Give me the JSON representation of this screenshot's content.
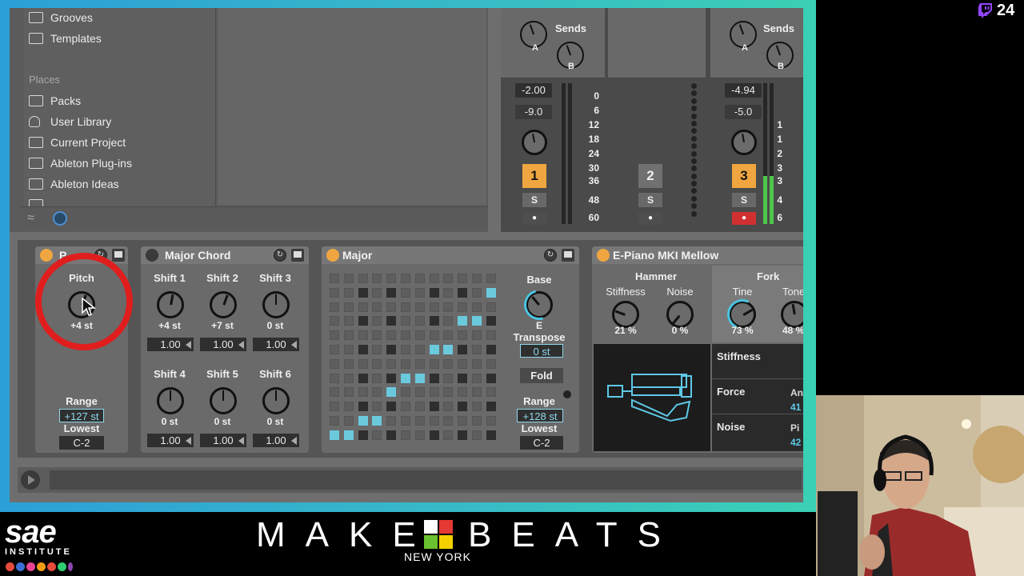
{
  "browser": {
    "items_top": [
      {
        "label": "Grooves",
        "icon": "grooves-icon"
      },
      {
        "label": "Templates",
        "icon": "templates-icon"
      }
    ],
    "places_header": "Places",
    "places": [
      {
        "label": "Packs",
        "icon": "packs-icon"
      },
      {
        "label": "User Library",
        "icon": "person-icon"
      },
      {
        "label": "Current Project",
        "icon": "project-icon"
      },
      {
        "label": "Ableton Plug-ins",
        "icon": "folder-icon"
      },
      {
        "label": "Ableton Ideas",
        "icon": "folder-icon"
      }
    ]
  },
  "mixer": {
    "sends_label": "Sends",
    "send_a": "A",
    "send_b": "B",
    "strip1": {
      "volume": "-2.00",
      "pan": "-9.0",
      "number": "1",
      "solo": "S"
    },
    "strip2": {
      "number": "2",
      "solo": "S"
    },
    "strip3": {
      "volume": "-4.94",
      "pan": "-5.0",
      "number": "3",
      "solo": "S"
    },
    "scale": [
      "0",
      "6",
      "12",
      "18",
      "24",
      "30",
      "36",
      "48",
      "60"
    ],
    "scale_partial": [
      "1",
      "1",
      "2",
      "3",
      "3",
      "4",
      "6"
    ]
  },
  "devices": {
    "pitch": {
      "name_partial": "P",
      "pitch_label": "Pitch",
      "pitch_value": "+4 st",
      "range_label": "Range",
      "range_value": "+127 st",
      "lowest_label": "Lowest",
      "lowest_value": "C-2"
    },
    "major_chord": {
      "name": "Major Chord",
      "shifts": [
        {
          "label": "Shift 1",
          "value": "+4 st",
          "vel": "1.00"
        },
        {
          "label": "Shift 2",
          "value": "+7 st",
          "vel": "1.00"
        },
        {
          "label": "Shift 3",
          "value": "0 st",
          "vel": "1.00"
        },
        {
          "label": "Shift 4",
          "value": "0 st",
          "vel": "1.00"
        },
        {
          "label": "Shift 5",
          "value": "0 st",
          "vel": "1.00"
        },
        {
          "label": "Shift 6",
          "value": "0 st",
          "vel": "1.00"
        }
      ]
    },
    "major": {
      "name": "Major",
      "base_label": "Base",
      "base_value": "E",
      "transpose_label": "Transpose",
      "transpose_value": "0 st",
      "fold_label": "Fold",
      "range_label": "Range",
      "range_value": "+128 st",
      "lowest_label": "Lowest",
      "lowest_value": "C-2"
    },
    "epiano": {
      "name": "E-Piano MKI Mellow",
      "hammer_label": "Hammer",
      "fork_label": "Fork",
      "stiffness_label": "Stiffness",
      "stiffness_value": "21 %",
      "noise_label": "Noise",
      "noise_value": "0 %",
      "tine_label": "Tine",
      "tine_value": "73 %",
      "tone_label": "Tone",
      "tone_value": "48 %",
      "table": [
        {
          "label": "Stiffness",
          "right_label": "",
          "right_value": ""
        },
        {
          "label": "Force",
          "right_label": "An",
          "right_value": "41"
        },
        {
          "label": "Noise",
          "right_label": "Pi",
          "right_value": "42"
        }
      ]
    }
  },
  "overlay": {
    "twitch_count": "24",
    "sae_name": "sae",
    "sae_institute": "INSTITUTE",
    "make_text": "MAKE",
    "beats_text": "BEATS",
    "new_york": "NEW YORK"
  },
  "colors": {
    "accent_orange": "#f0a640",
    "accent_cyan": "#6bc9dc",
    "highlight_red": "#e01e1e",
    "frame_start": "#2a9fd8",
    "frame_end": "#3ad0b5"
  }
}
